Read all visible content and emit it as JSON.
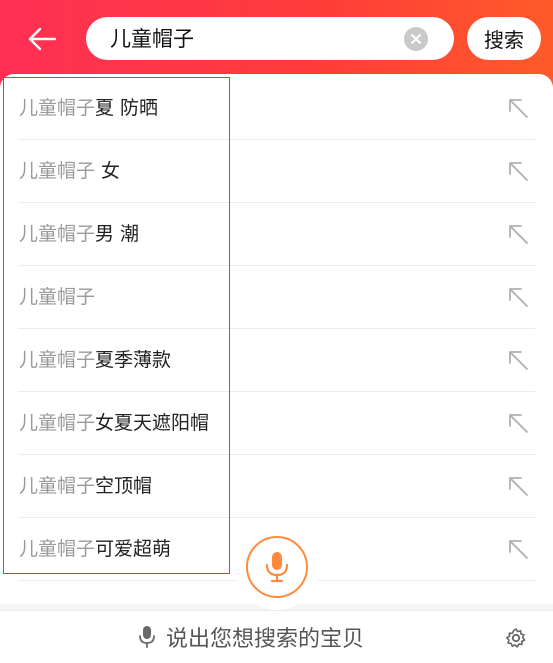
{
  "search": {
    "query": "儿童帽子",
    "button_label": "搜索"
  },
  "suggestions": [
    {
      "prefix": "儿童帽子",
      "suffix": "夏 防晒"
    },
    {
      "prefix": "儿童帽子",
      "suffix": " 女"
    },
    {
      "prefix": "儿童帽子",
      "suffix": "男 潮"
    },
    {
      "prefix": "儿童帽子",
      "suffix": ""
    },
    {
      "prefix": "儿童帽子",
      "suffix": "夏季薄款"
    },
    {
      "prefix": "儿童帽子",
      "suffix": "女夏天遮阳帽"
    },
    {
      "prefix": "儿童帽子",
      "suffix": "空顶帽"
    },
    {
      "prefix": "儿童帽子",
      "suffix": "可爱超萌"
    }
  ],
  "voice": {
    "hint": "说出您想搜索的宝贝"
  },
  "icons": {
    "back": "arrow-left-icon",
    "clear": "clear-icon",
    "fill": "arrow-up-left-icon",
    "mic": "microphone-icon",
    "settings": "gear-icon"
  },
  "colors": {
    "header_start": "#ff2f55",
    "header_end": "#ff5a2a",
    "mic_accent": "#ff8a3d",
    "highlight": "#e23a3a"
  }
}
